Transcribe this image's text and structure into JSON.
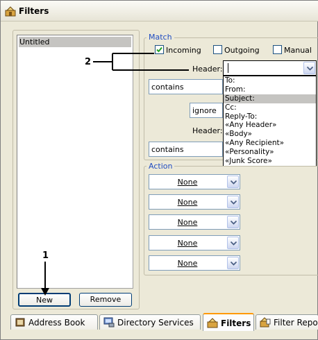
{
  "window": {
    "title": "Filters"
  },
  "filter_list": {
    "items": [
      {
        "label": "Untitled",
        "selected": true
      }
    ]
  },
  "buttons": {
    "new": "New",
    "remove": "Remove"
  },
  "match": {
    "group_label": "Match",
    "incoming": {
      "label": "Incoming",
      "checked": true
    },
    "outgoing": {
      "label": "Outgoing",
      "checked": false
    },
    "manual": {
      "label": "Manual",
      "checked": false
    },
    "header1_label": "Header:",
    "header1_value": "",
    "condition1": "contains",
    "conjunction": "ignore",
    "header2_label": "Header:",
    "condition2": "contains"
  },
  "header_dropdown": {
    "options": [
      "To:",
      "From:",
      "Subject:",
      "Cc:",
      "Reply-To:",
      "«Any Header»",
      "«Body»",
      "«Any Recipient»",
      "«Personality»",
      "«Junk Score»"
    ],
    "highlighted": "Subject:"
  },
  "action": {
    "group_label": "Action",
    "items": [
      {
        "value": "None"
      },
      {
        "value": "None"
      },
      {
        "value": "None"
      },
      {
        "value": "None"
      },
      {
        "value": "None"
      }
    ]
  },
  "tabs": [
    {
      "label": "Address Book",
      "icon": "address-book-icon",
      "active": false
    },
    {
      "label": "Directory Services",
      "icon": "directory-services-icon",
      "active": false
    },
    {
      "label": "Filters",
      "icon": "filters-icon",
      "active": true
    },
    {
      "label": "Filter Report",
      "icon": "filter-report-icon",
      "active": false
    }
  ],
  "callouts": {
    "one": "1",
    "two": "2"
  },
  "colors": {
    "group_label": "#1f4cc2",
    "active_tab_accent": "#ff9900",
    "selection": "#c5c4c1"
  }
}
